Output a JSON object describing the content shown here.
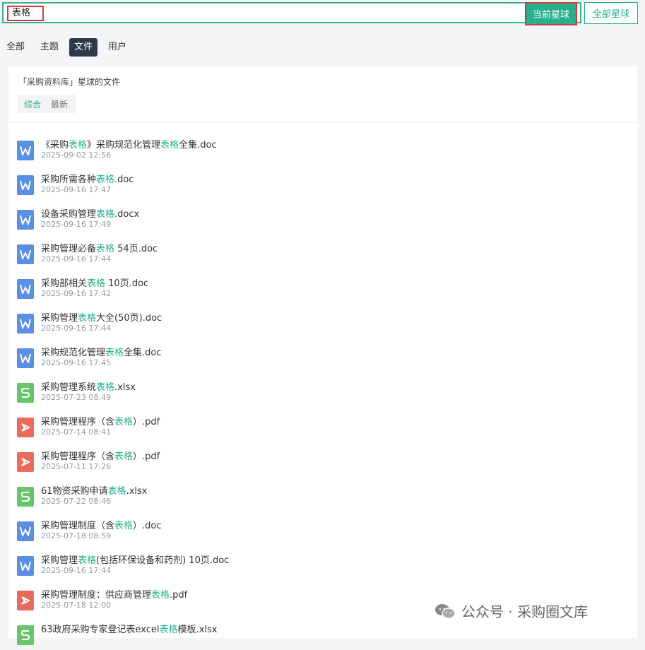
{
  "search": {
    "query": "表格"
  },
  "buttons": {
    "current_planet": "当前星球",
    "all_planets": "全部星球"
  },
  "tabs": [
    {
      "label": "全部"
    },
    {
      "label": "主题"
    },
    {
      "label": "文件",
      "active": true
    },
    {
      "label": "用户"
    }
  ],
  "scope": {
    "title": "「采购资料库」星球的文件"
  },
  "sort": {
    "options": [
      "综合",
      "最新"
    ],
    "active": "综合"
  },
  "files": [
    {
      "type": "doc",
      "pre": "《采购",
      "hl": "表格",
      "mid": "》采购规范化管理",
      "hl2": "表格",
      "post": "全集.doc",
      "time": "2025-09-02 12:56"
    },
    {
      "type": "doc",
      "pre": "采购所需各种",
      "hl": "表格",
      "mid": ".doc",
      "hl2": "",
      "post": "",
      "time": "2025-09-16 17:47"
    },
    {
      "type": "doc",
      "pre": "设备采购管理",
      "hl": "表格",
      "mid": ".docx",
      "hl2": "",
      "post": "",
      "time": "2025-09-16 17:49"
    },
    {
      "type": "doc",
      "pre": "采购管理必备",
      "hl": "表格",
      "mid": " 54页.doc",
      "hl2": "",
      "post": "",
      "time": "2025-09-16 17:44"
    },
    {
      "type": "doc",
      "pre": "采购部相关",
      "hl": "表格",
      "mid": " 10页.doc",
      "hl2": "",
      "post": "",
      "time": "2025-09-16 17:42"
    },
    {
      "type": "doc",
      "pre": "采购管理",
      "hl": "表格",
      "mid": "大全(50页).doc",
      "hl2": "",
      "post": "",
      "time": "2025-09-16 17:44"
    },
    {
      "type": "doc",
      "pre": "采购规范化管理",
      "hl": "表格",
      "mid": "全集.doc",
      "hl2": "",
      "post": "",
      "time": "2025-09-16 17:45"
    },
    {
      "type": "xls",
      "pre": "采购管理系统",
      "hl": "表格",
      "mid": ".xlsx",
      "hl2": "",
      "post": "",
      "time": "2025-07-23 08:49"
    },
    {
      "type": "pdf",
      "pre": "采购管理程序（含",
      "hl": "表格",
      "mid": "）.pdf",
      "hl2": "",
      "post": "",
      "time": "2025-07-14 08:41"
    },
    {
      "type": "pdf",
      "pre": "采购管理程序（含",
      "hl": "表格",
      "mid": "）.pdf",
      "hl2": "",
      "post": "",
      "time": "2025-07-11 17:26"
    },
    {
      "type": "xls",
      "pre": "61物资采购申请",
      "hl": "表格",
      "mid": ".xlsx",
      "hl2": "",
      "post": "",
      "time": "2025-07-22 08:46"
    },
    {
      "type": "doc",
      "pre": "采购管理制度（含",
      "hl": "表格",
      "mid": "）.doc",
      "hl2": "",
      "post": "",
      "time": "2025-07-18 08:59"
    },
    {
      "type": "doc",
      "pre": "采购管理",
      "hl": "表格",
      "mid": "(包括环保设备和药剂) 10页.doc",
      "hl2": "",
      "post": "",
      "time": "2025-09-16 17:44"
    },
    {
      "type": "pdf",
      "pre": "采购管理制度：供应商管理",
      "hl": "表格",
      "mid": ".pdf",
      "hl2": "",
      "post": "",
      "time": "2025-07-18 12:00"
    },
    {
      "type": "xls",
      "pre": "63政府采购专家登记表excel",
      "hl": "表格",
      "mid": "模板.xlsx",
      "hl2": "",
      "post": "",
      "time": ""
    }
  ],
  "watermark": {
    "text": "公众号 · 采购圈文库",
    "icon": "wechat-icon"
  },
  "colors": {
    "accent": "#26b08b",
    "highlight_border": "#d9363e",
    "doc": "#5b8fe6",
    "xls": "#67c56c",
    "pdf": "#eb6a5c"
  }
}
